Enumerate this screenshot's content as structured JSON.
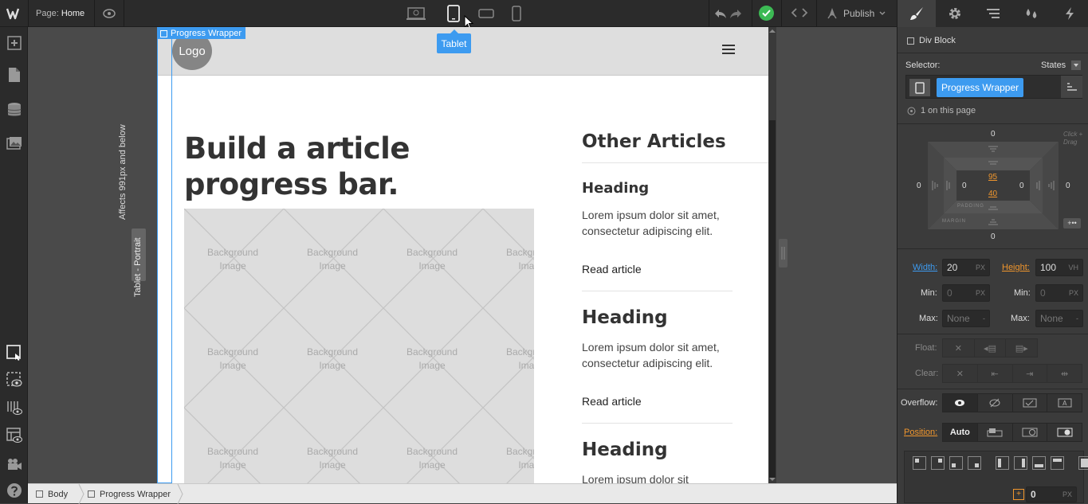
{
  "topbar": {
    "page_label": "Page:",
    "page_name": "Home",
    "tooltip": "Tablet",
    "publish_label": "Publish"
  },
  "canvas": {
    "selected_element_label": "Progress Wrapper",
    "logo": "Logo",
    "headline": "Build a article progress bar.",
    "bg_image_label": "Background Image",
    "sidebar_title": "Other Articles",
    "articles": [
      {
        "heading": "Heading",
        "body": "Lorem ipsum dolor sit amet, consectetur adipiscing elit.",
        "link": "Read article"
      },
      {
        "heading": "Heading",
        "body": "Lorem ipsum dolor sit amet, consectetur adipiscing elit.",
        "link": "Read article"
      },
      {
        "heading": "Heading",
        "body": "Lorem ipsum dolor sit"
      }
    ],
    "affects_label": "Affects 991px and below",
    "breakpoint_tag": "Tablet - Portrait"
  },
  "breadcrumb": {
    "items": [
      "Body",
      "Progress Wrapper"
    ]
  },
  "style_panel": {
    "element_type": "Div Block",
    "selector_label": "Selector:",
    "states_label": "States",
    "selector_chip": "Progress Wrapper",
    "on_page": "1 on this page",
    "box_model": {
      "margin_top": "0",
      "margin_bottom": "0",
      "margin_left": "0",
      "margin_right": "0",
      "padding_left": "0",
      "padding_right": "0",
      "padding_top": "95",
      "padding_bottom": "40",
      "padding_label": "PADDING",
      "margin_label": "MARGIN",
      "hint": "Click + Drag"
    },
    "width_label": "Width:",
    "width_value": "20",
    "width_unit": "PX",
    "height_label": "Height:",
    "height_value": "100",
    "height_unit": "VH",
    "min_label": "Min:",
    "min_w": "0",
    "min_w_unit": "PX",
    "min_h": "0",
    "min_h_unit": "PX",
    "max_label": "Max:",
    "max_w": "None",
    "max_h": "None",
    "max_unit": "-",
    "float_label": "Float:",
    "clear_label": "Clear:",
    "overflow_label": "Overflow:",
    "position_label": "Position:",
    "position_value": "Auto",
    "bottom_value": "0",
    "bottom_unit": "PX"
  },
  "colors": {
    "accent": "#3d9bf0",
    "published_ok": "#3cba54",
    "orange": "#f0962d"
  }
}
